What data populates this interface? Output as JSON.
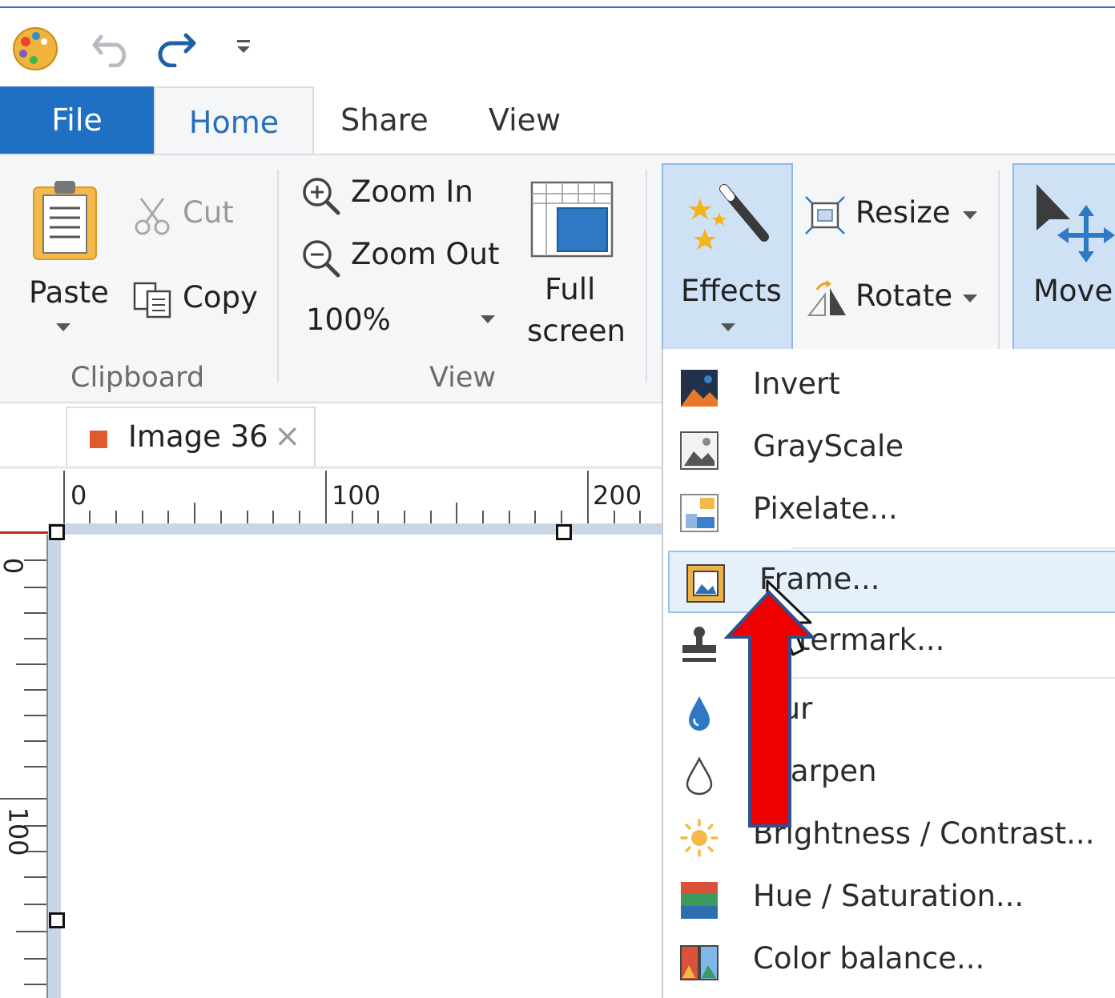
{
  "quick_access": {
    "app_icon": "palette-icon",
    "undo_icon": "undo-icon",
    "redo_icon": "redo-icon",
    "customize_icon": "customize-toolbar-icon"
  },
  "tabs": [
    "File",
    "Home",
    "Share",
    "View"
  ],
  "clipboard": {
    "paste": "Paste",
    "cut": "Cut",
    "copy": "Copy",
    "group": "Clipboard"
  },
  "view": {
    "zoom_in": "Zoom In",
    "zoom_out": "Zoom Out",
    "zoom_value": "100%",
    "full_screen_line1": "Full",
    "full_screen_line2": "screen",
    "group": "View"
  },
  "image": {
    "effects": "Effects",
    "resize": "Resize",
    "rotate": "Rotate",
    "move": "Move"
  },
  "document_tab": {
    "title": "Image 36",
    "close": "×"
  },
  "rulers": {
    "h_labels": [
      "0",
      "100",
      "200"
    ],
    "v_labels": [
      "0",
      "100"
    ]
  },
  "effects_menu": [
    {
      "label": "Invert",
      "icon": "invert-icon"
    },
    {
      "label": "GrayScale",
      "icon": "grayscale-icon"
    },
    {
      "label": "Pixelate...",
      "icon": "pixelate-icon"
    },
    {
      "label": "Frame...",
      "icon": "frame-icon",
      "highlighted": true
    },
    {
      "label": "Watermark...",
      "icon": "watermark-stamp-icon"
    },
    {
      "label": "Blur",
      "icon": "blur-drop-icon"
    },
    {
      "label": "Sharpen",
      "icon": "sharpen-drop-icon"
    },
    {
      "label": "Brightness / Contrast...",
      "icon": "brightness-sun-icon"
    },
    {
      "label": "Hue / Saturation...",
      "icon": "hue-saturation-icon"
    },
    {
      "label": "Color balance...",
      "icon": "color-balance-icon"
    }
  ],
  "colors": {
    "file_tab": "#1f6fc3",
    "home_tab_text": "#2a6ebb",
    "accent_selected": "#cfe2f5",
    "annotation_arrow": "#ee0000",
    "annotation_arrow_border": "#2f4f8f"
  }
}
